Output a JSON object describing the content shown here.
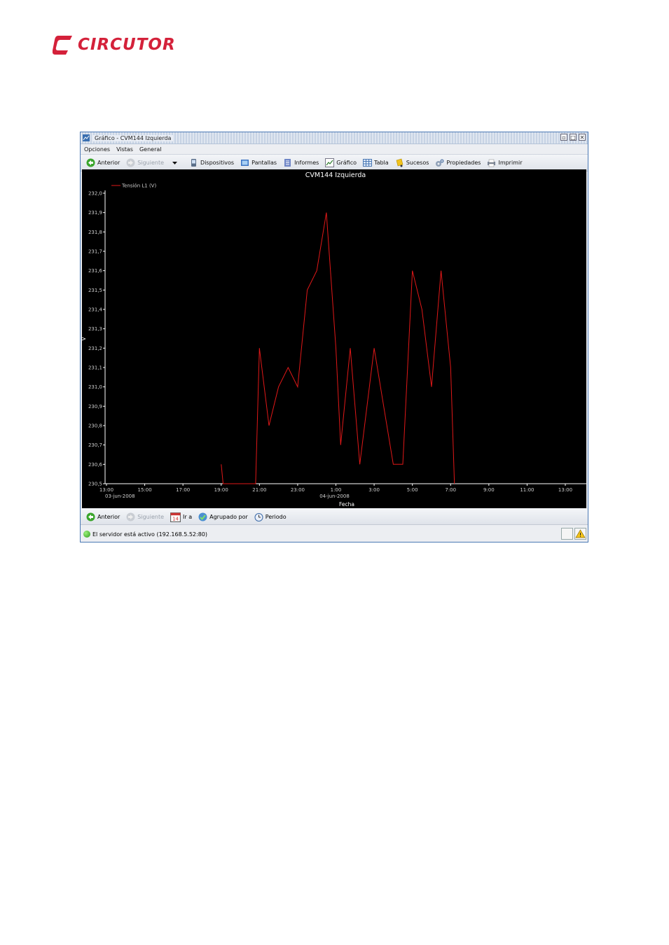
{
  "logo": {
    "text": "CIRCUTOR",
    "color": "#d4213a"
  },
  "window": {
    "title": "Gráfico - CVM144 Izquierda",
    "controls": [
      "restore-icon",
      "maximize-icon",
      "close-icon"
    ]
  },
  "menu": {
    "items": [
      "Opciones",
      "Vistas",
      "General"
    ]
  },
  "toolbar": {
    "items": [
      {
        "label": "Anterior",
        "icon": "back-arrow-icon",
        "enabled": true
      },
      {
        "label": "Siguiente",
        "icon": "forward-arrow-icon",
        "enabled": false
      },
      {
        "label": "Dispositivos",
        "icon": "device-icon",
        "enabled": true
      },
      {
        "label": "Pantallas",
        "icon": "screen-icon",
        "enabled": true
      },
      {
        "label": "Informes",
        "icon": "report-icon",
        "enabled": true
      },
      {
        "label": "Gráfico",
        "icon": "chart-icon",
        "enabled": true
      },
      {
        "label": "Tabla",
        "icon": "table-icon",
        "enabled": true
      },
      {
        "label": "Sucesos",
        "icon": "bell-icon",
        "enabled": true
      },
      {
        "label": "Propiedades",
        "icon": "gear-icon",
        "enabled": true
      },
      {
        "label": "Imprimir",
        "icon": "printer-icon",
        "enabled": true
      }
    ]
  },
  "chart_data": {
    "type": "line",
    "title": "CVM144 Izquierda",
    "ylabel": "V",
    "xlabel": "Fecha",
    "ylim": [
      230.5,
      232.0
    ],
    "y_ticks": [
      "230,5",
      "230,6",
      "230,7",
      "230,8",
      "230,9",
      "231,0",
      "231,1",
      "231,2",
      "231,3",
      "231,4",
      "231,5",
      "231,6",
      "231,7",
      "231,8",
      "231,9",
      "232,0"
    ],
    "x_ticks": [
      "13:00",
      "15:00",
      "17:00",
      "19:00",
      "21:00",
      "23:00",
      "1:00",
      "3:00",
      "5:00",
      "7:00",
      "9:00",
      "11:00",
      "13:00"
    ],
    "x_date_labels": [
      {
        "tick": "13:00",
        "date": "03-jun-2008"
      },
      {
        "tick": "1:00",
        "date": "04-jun-2008"
      }
    ],
    "legend_position": "top-left",
    "series": [
      {
        "name": "Tensión L1 (V)",
        "color": "#e01818",
        "points": [
          [
            "03-jun-2008 19:00",
            230.6
          ],
          [
            "03-jun-2008 19:06",
            230.5
          ],
          [
            "03-jun-2008 20:48",
            230.5
          ],
          [
            "03-jun-2008 21:00",
            231.2
          ],
          [
            "03-jun-2008 21:30",
            230.8
          ],
          [
            "03-jun-2008 22:00",
            231.0
          ],
          [
            "03-jun-2008 22:30",
            231.1
          ],
          [
            "03-jun-2008 23:00",
            231.0
          ],
          [
            "03-jun-2008 23:30",
            231.5
          ],
          [
            "04-jun-2008 00:00",
            231.6
          ],
          [
            "04-jun-2008 00:30",
            231.9
          ],
          [
            "04-jun-2008 01:00",
            231.2
          ],
          [
            "04-jun-2008 01:15",
            230.7
          ],
          [
            "04-jun-2008 01:45",
            231.2
          ],
          [
            "04-jun-2008 02:15",
            230.6
          ],
          [
            "04-jun-2008 02:45",
            231.0
          ],
          [
            "04-jun-2008 03:00",
            231.2
          ],
          [
            "04-jun-2008 03:30",
            230.9
          ],
          [
            "04-jun-2008 04:00",
            230.6
          ],
          [
            "04-jun-2008 04:30",
            230.6
          ],
          [
            "04-jun-2008 05:00",
            231.6
          ],
          [
            "04-jun-2008 05:30",
            231.4
          ],
          [
            "04-jun-2008 06:00",
            231.0
          ],
          [
            "04-jun-2008 06:30",
            231.6
          ],
          [
            "04-jun-2008 07:00",
            231.1
          ],
          [
            "04-jun-2008 07:12",
            230.5
          ]
        ]
      }
    ]
  },
  "bottombar": {
    "items": [
      {
        "label": "Anterior",
        "icon": "back-arrow-icon",
        "enabled": true
      },
      {
        "label": "Siguiente",
        "icon": "forward-arrow-icon",
        "enabled": false
      },
      {
        "label": "Ir a",
        "icon": "calendar-icon",
        "enabled": true
      },
      {
        "label": "Agrupado por",
        "icon": "group-icon",
        "enabled": true
      },
      {
        "label": "Periodo",
        "icon": "clock-icon",
        "enabled": true
      }
    ],
    "calendar_day": "14"
  },
  "status": {
    "text": "El servidor está activo (192.168.5.52:80)"
  }
}
